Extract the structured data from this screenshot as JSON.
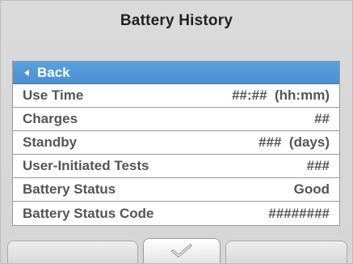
{
  "header": {
    "title": "Battery History"
  },
  "menu": {
    "back_label": "Back",
    "rows": [
      {
        "label": "Use Time",
        "value": "##:##  (hh:mm)"
      },
      {
        "label": "Charges",
        "value": "##"
      },
      {
        "label": "Standby",
        "value": "###  (days)"
      },
      {
        "label": "User-Initiated Tests",
        "value": "###"
      },
      {
        "label": "Battery Status",
        "value": "Good"
      },
      {
        "label": "Battery Status Code",
        "value": "########"
      }
    ]
  },
  "softkeys": {
    "center_icon": "check-icon"
  },
  "colors": {
    "selected_row": "#4a90d3",
    "background": "#d8d8d8",
    "text": "#555555"
  }
}
